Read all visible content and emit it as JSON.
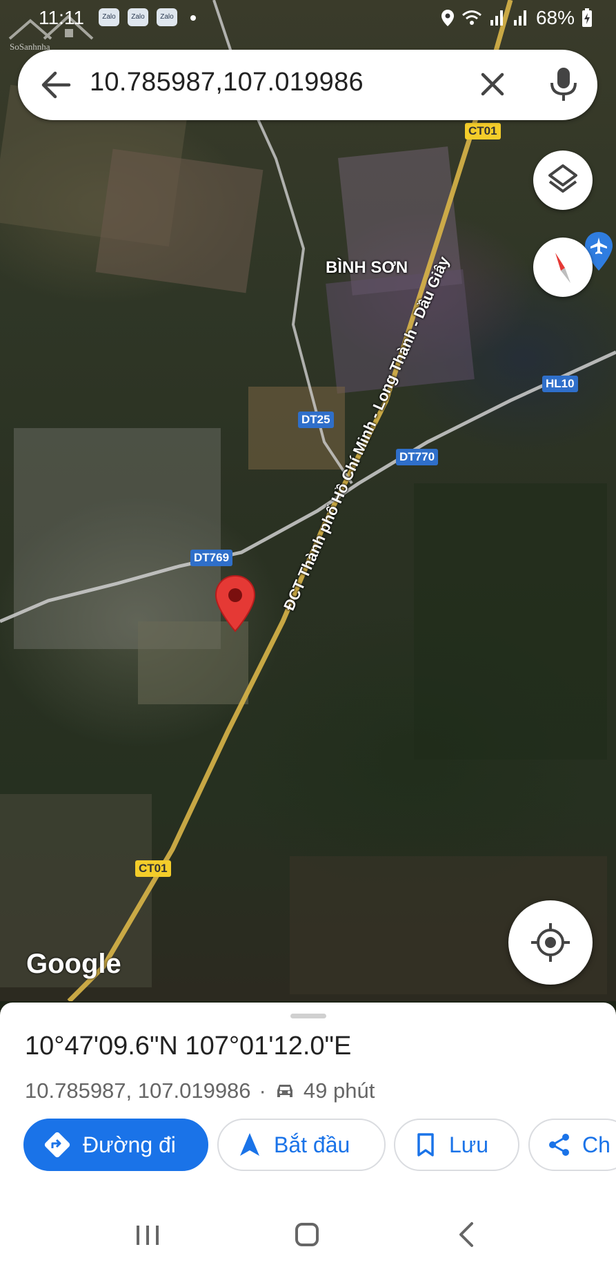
{
  "status_bar": {
    "time": "11:11",
    "notifications": [
      "Zalo",
      "Zalo",
      "Zalo"
    ],
    "battery": "68%"
  },
  "watermark": {
    "text": "SoSanhnha"
  },
  "search": {
    "query": "10.785987,107.019986"
  },
  "map": {
    "place_label": "BÌNH SƠN",
    "road_name": "ĐCT Thành phố Hồ Chí Minh - Long Thành - Dầu Giây",
    "shields": {
      "ct01_top": "CT01",
      "ct01_bottom": "CT01",
      "dt25": "DT25",
      "dt770": "DT770",
      "hl10": "HL10",
      "dt769": "DT769"
    },
    "attribution": "Google",
    "accent_colors": {
      "pin": "#e53935",
      "shield_yellow": "#f4cd2a",
      "shield_blue": "#2f6fca"
    }
  },
  "sheet": {
    "coords_dms": "10°47'09.6\"N 107°01'12.0\"E",
    "coords_decimal": "10.785987, 107.019986",
    "separator": "·",
    "travel_time": "49 phút",
    "buttons": {
      "directions": "Đường đi",
      "start": "Bắt đầu",
      "save": "Lưu",
      "share": "Ch"
    },
    "accent": "#1a73e8"
  }
}
